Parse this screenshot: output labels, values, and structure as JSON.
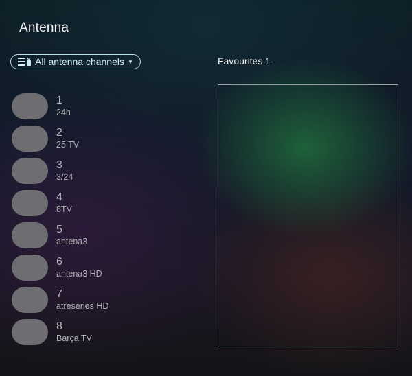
{
  "header": {
    "title": "Antenna"
  },
  "filter": {
    "label": "All antenna channels",
    "icon": "channel-list-icon"
  },
  "channels": [
    {
      "number": "1",
      "name": "24h"
    },
    {
      "number": "2",
      "name": "25 TV"
    },
    {
      "number": "3",
      "name": "3/24"
    },
    {
      "number": "4",
      "name": "8TV"
    },
    {
      "number": "5",
      "name": "antena3"
    },
    {
      "number": "6",
      "name": "antena3 HD"
    },
    {
      "number": "7",
      "name": "atreseries HD"
    },
    {
      "number": "8",
      "name": "Barça TV"
    }
  ],
  "favourites": {
    "title": "Favourites 1"
  },
  "colors": {
    "accent": "#b9e3e6",
    "logo_placeholder": "#6e6e72"
  }
}
